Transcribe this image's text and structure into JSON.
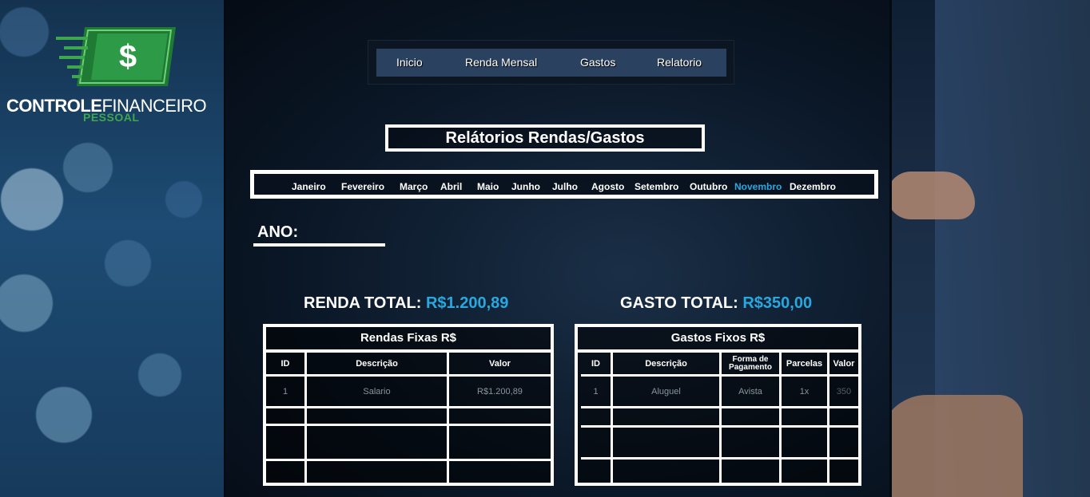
{
  "logo": {
    "title_bold": "CONTROLE",
    "title_thin": "FINANCEIRO",
    "subtitle": "PESSOAL",
    "symbol": "$"
  },
  "nav": {
    "items": [
      {
        "label": "Inicio"
      },
      {
        "label": "Renda Mensal"
      },
      {
        "label": "Gastos"
      },
      {
        "label": "Relatorio"
      }
    ]
  },
  "page_title": "Relátorios Rendas/Gastos",
  "months": [
    {
      "label": "Janeiro",
      "active": false
    },
    {
      "label": "Fevereiro",
      "active": false
    },
    {
      "label": "Março",
      "active": false
    },
    {
      "label": "Abril",
      "active": false
    },
    {
      "label": "Maio",
      "active": false
    },
    {
      "label": "Junho",
      "active": false
    },
    {
      "label": "Julho",
      "active": false
    },
    {
      "label": "Agosto",
      "active": false
    },
    {
      "label": "Setembro",
      "active": false
    },
    {
      "label": "Outubro",
      "active": false
    },
    {
      "label": "Novembro",
      "active": true
    },
    {
      "label": "Dezembro",
      "active": false
    }
  ],
  "year": {
    "label": "ANO:",
    "value": ""
  },
  "totals": {
    "renda_label": "RENDA TOTAL:",
    "renda_value": "R$1.200,89",
    "gasto_label": "GASTO TOTAL:",
    "gasto_value": "R$350,00"
  },
  "rendas_table": {
    "caption": "Rendas Fixas R$",
    "headers": [
      "ID",
      "Descrição",
      "Valor"
    ],
    "rows": [
      [
        "1",
        "Salario",
        "R$1.200,89"
      ],
      [
        "",
        "",
        ""
      ],
      [
        "",
        "",
        ""
      ],
      [
        "",
        "",
        ""
      ]
    ]
  },
  "gastos_table": {
    "caption": "Gastos Fixos R$",
    "headers": [
      "ID",
      "Descrição",
      "Forma de Pagamento",
      "Parcelas",
      "Valor"
    ],
    "rows": [
      [
        "1",
        "Aluguel",
        "Avista",
        "1x",
        "350"
      ],
      [
        "",
        "",
        "",
        "",
        ""
      ],
      [
        "",
        "",
        "",
        "",
        ""
      ],
      [
        "",
        "",
        "",
        "",
        ""
      ]
    ]
  },
  "colors": {
    "accent": "#29a8e0",
    "logo_green": "#3fa650",
    "nav_bg": "#2a4260"
  }
}
